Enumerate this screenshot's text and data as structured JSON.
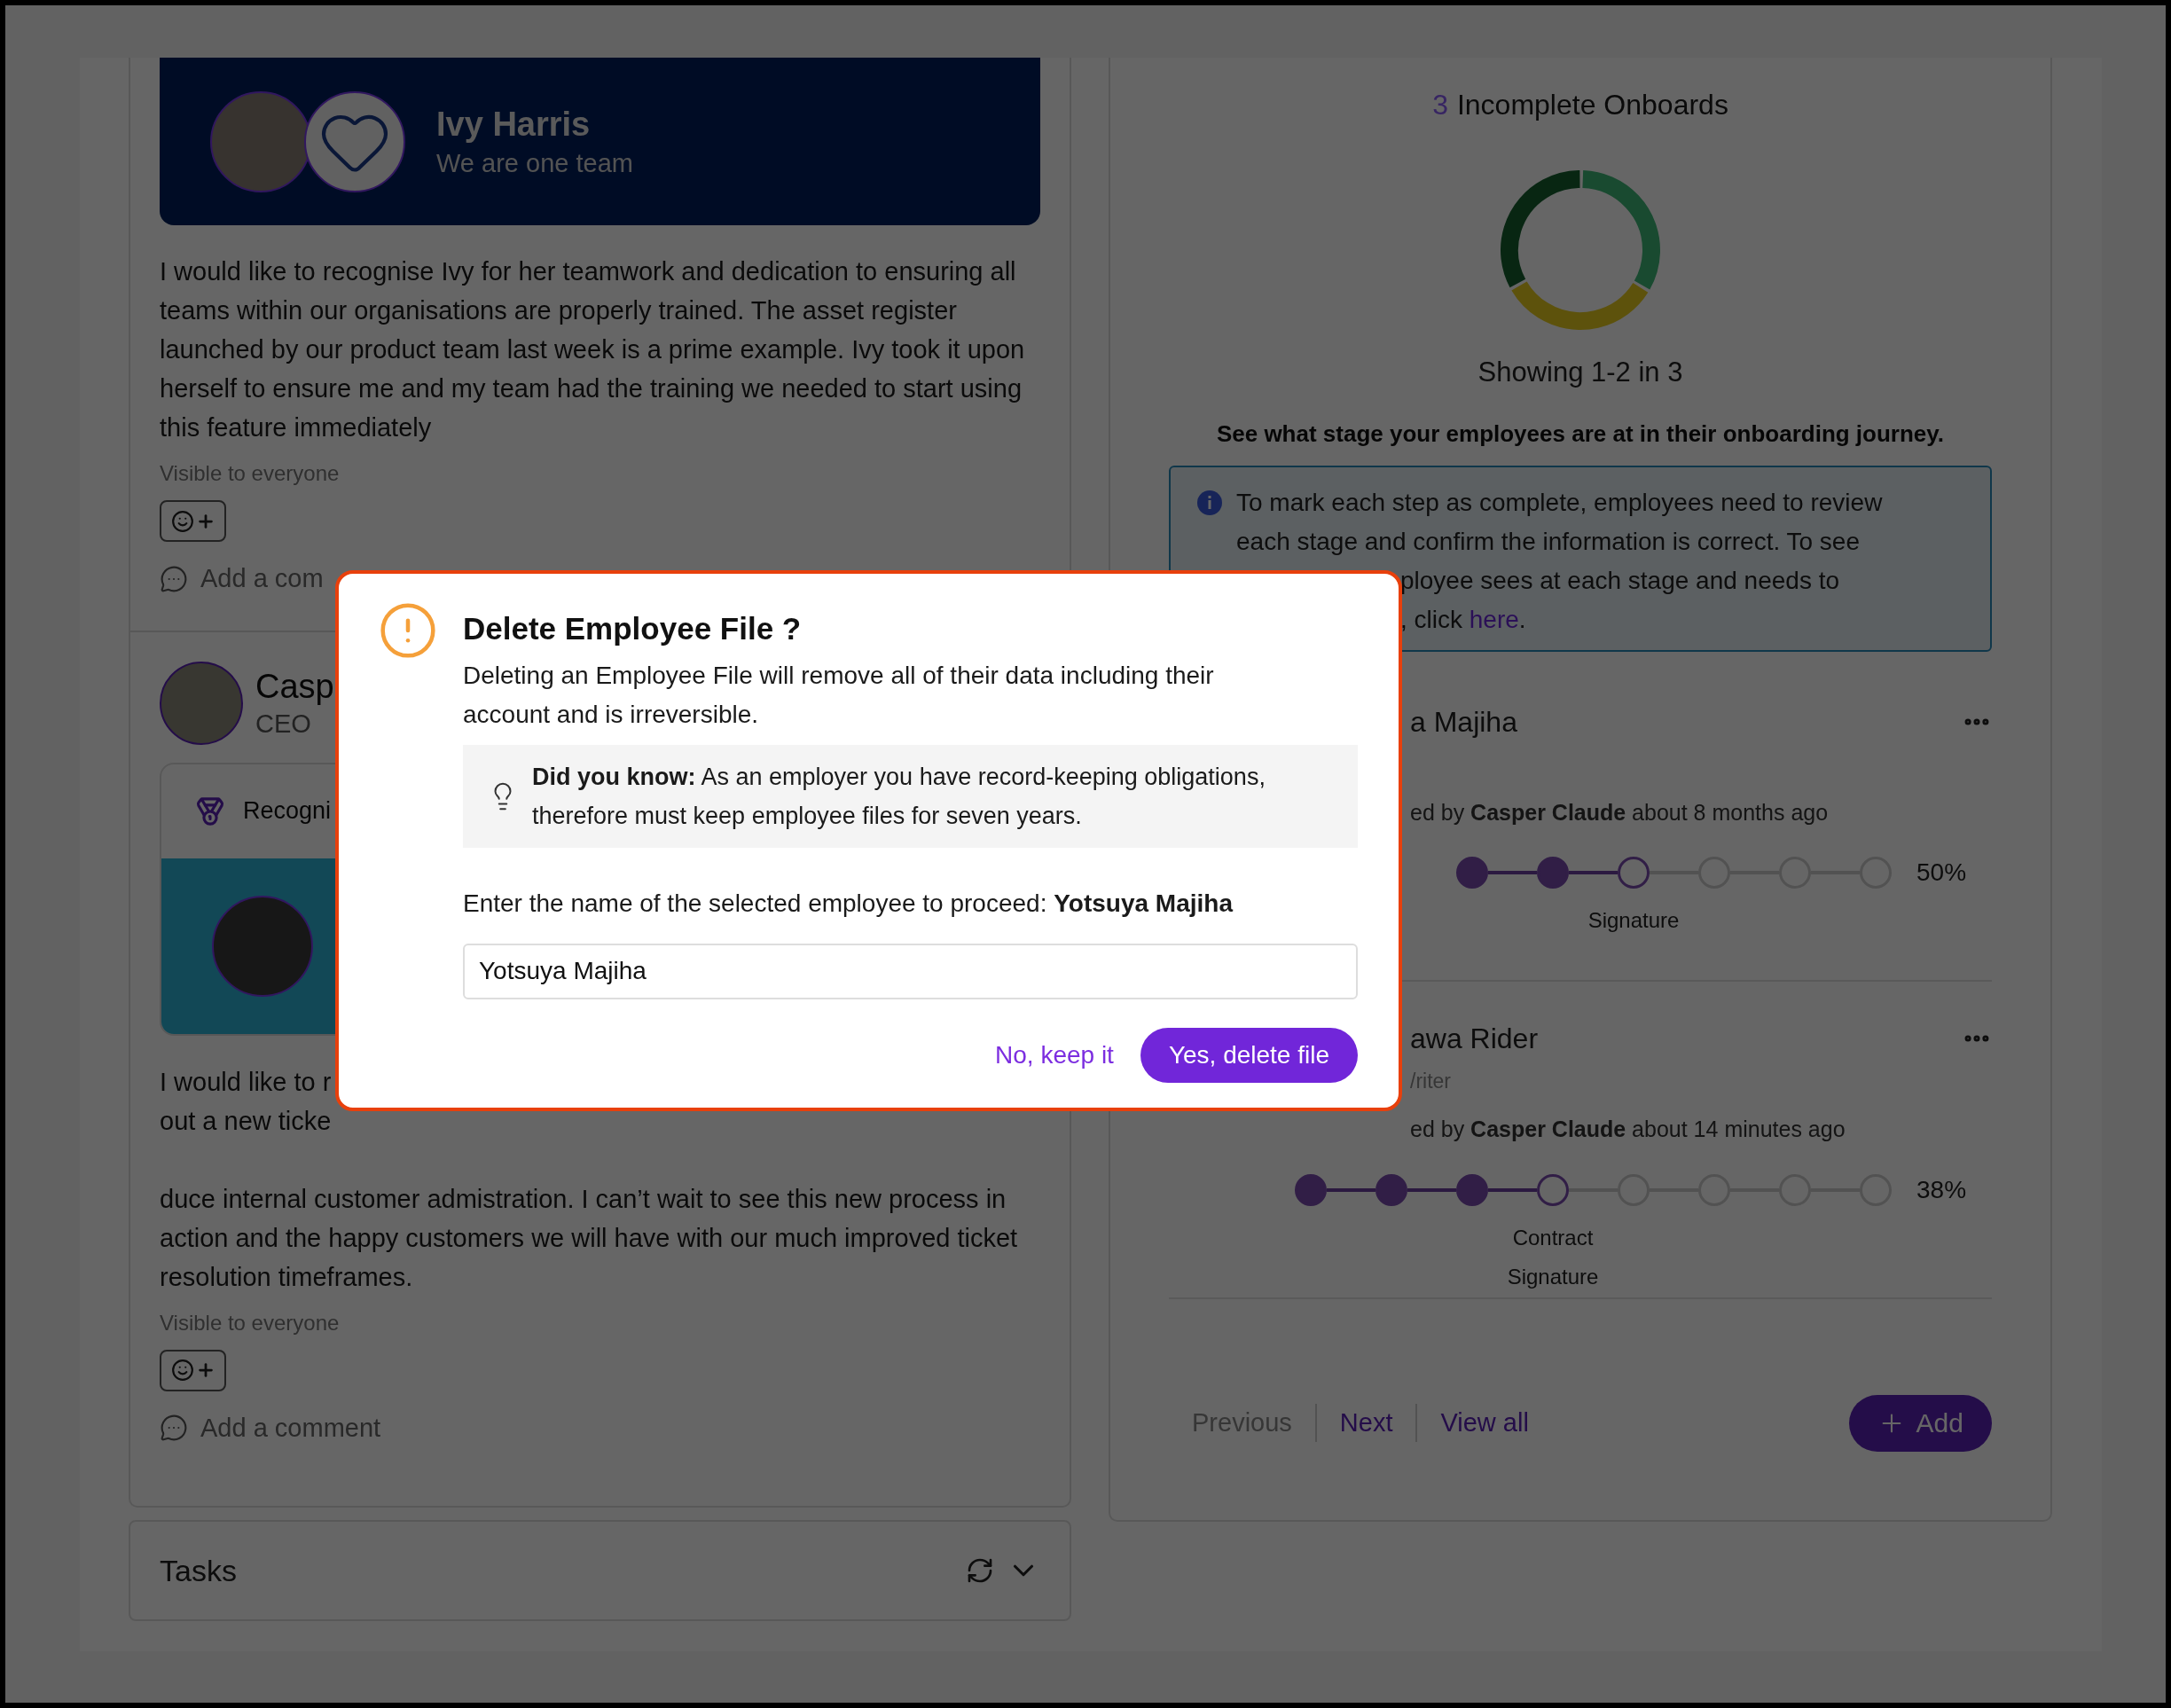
{
  "feed": {
    "posts": [
      {
        "kind": "banner",
        "recognition": {
          "name": "Ivy Harris",
          "subtitle": "We are one team"
        },
        "body": "I would like to recognise Ivy for her teamwork and dedication to ensuring all teams within our organisations are properly trained. The asset register launched by our product team last week is a prime example. Ivy took it upon herself to ensure me and my team had the training we needed to start using this feature immediately",
        "visibility": "Visible to everyone",
        "comment_prompt": "Add a com"
      },
      {
        "kind": "card",
        "author": {
          "name": "Casp",
          "role": "CEO"
        },
        "recognition": {
          "label": "Recogni"
        },
        "body_lines": [
          "I would like to r",
          "out a new ticke"
        ],
        "body": "duce internal customer admistration. I can’t wait to see this new process in action and the happy customers we will have with our much improved ticket resolution timeframes.",
        "visibility": "Visible to everyone",
        "comment_prompt": "Add a comment"
      }
    ]
  },
  "tasks": {
    "title": "Tasks"
  },
  "onboarding": {
    "count": "3",
    "title": "Incomplete Onboards",
    "showing": "Showing 1-2 in 3",
    "heading": "See what stage your employees are at in their onboarding journey.",
    "info": {
      "text": "To mark each step as complete, employees need to review each stage and confirm the information is correct. To see",
      "fragment": "ployee sees at each stage and needs to",
      "tail": ", click ",
      "link": "here",
      "end": "."
    },
    "employees": [
      {
        "name": "a Majiha",
        "added_by": "ed by **Casper Claude** about 8 months ago",
        "steps": [
          {
            "kind": "done"
          },
          {
            "kind": "done"
          },
          {
            "kind": "current"
          },
          {
            "kind": "todo"
          },
          {
            "kind": "todo"
          },
          {
            "kind": "todo"
          }
        ],
        "percent": "50%",
        "stage": "Signature"
      },
      {
        "name": "awa Rider",
        "role": "/riter",
        "added_by": "ed by **Casper Claude** about 14 minutes ago",
        "steps": [
          {
            "kind": "done"
          },
          {
            "kind": "done"
          },
          {
            "kind": "done"
          },
          {
            "kind": "current"
          },
          {
            "kind": "todo"
          },
          {
            "kind": "todo"
          },
          {
            "kind": "todo"
          },
          {
            "kind": "todo"
          }
        ],
        "percent": "38%",
        "stage": "Contract Signature"
      }
    ],
    "pagination": [
      {
        "label": "Previous",
        "disabled": true
      },
      {
        "label": "Next",
        "disabled": false
      },
      {
        "label": "View all",
        "disabled": false
      }
    ],
    "add_button": "Add"
  },
  "dialog": {
    "title": "Delete Employee File ?",
    "message": "Deleting an Employee File will remove all of their data including their account and is irreversible.",
    "tip": "**Did you know:** As an employer you have record-keeping obligations, therefore must keep employee files for seven years.",
    "prompt": "Enter the name of the selected employee to proceed: **Yotsuya Majiha**",
    "input_value": "Yotsuya Majiha",
    "buttons": [
      {
        "label": "No, keep it",
        "kind": "secondary"
      },
      {
        "label": "Yes, delete file",
        "kind": "primary"
      }
    ]
  }
}
